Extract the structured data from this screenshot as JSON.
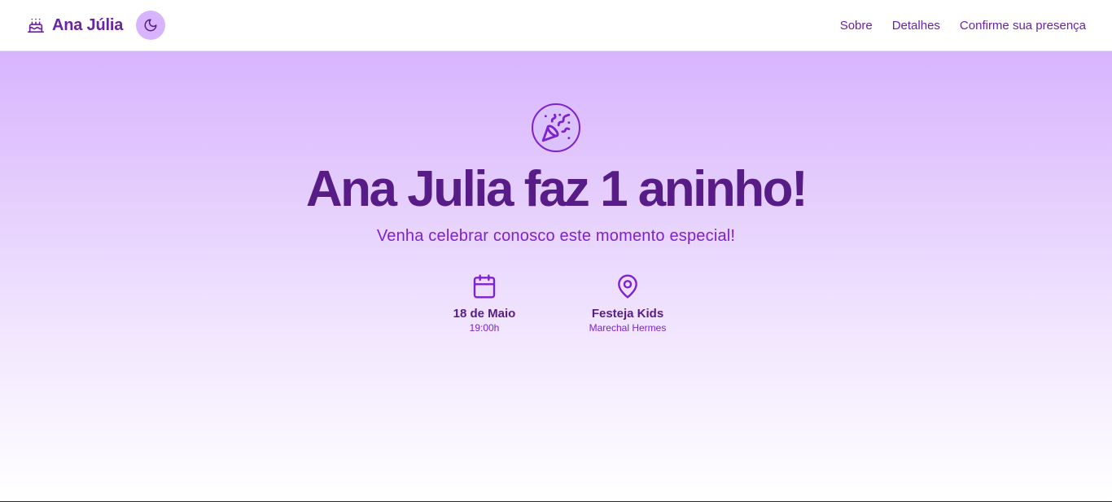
{
  "header": {
    "brand_name": "Ana Júlia",
    "brand_icon": "cake-icon",
    "theme_toggle_icon": "moon-icon",
    "nav": [
      {
        "label": "Sobre"
      },
      {
        "label": "Detalhes"
      },
      {
        "label": "Confirme sua presença"
      }
    ]
  },
  "hero": {
    "badge_icon": "party-popper-icon",
    "title": "Ana Julia faz 1 aninho!",
    "subtitle": "Venha celebrar conosco este momento especial!",
    "date": {
      "icon": "calendar-icon",
      "main": "18 de Maio",
      "sub": "19:00h"
    },
    "location": {
      "icon": "map-pin-icon",
      "main": "Festeja Kids",
      "sub": "Marechal Hermes"
    }
  },
  "colors": {
    "primary": "#6b21a8",
    "title": "#581c87",
    "accent": "#7e22ce",
    "toggle_bg": "#d8b4fe",
    "hero_gradient_top": "#d8b4fe",
    "hero_gradient_bottom": "#ffffff"
  }
}
